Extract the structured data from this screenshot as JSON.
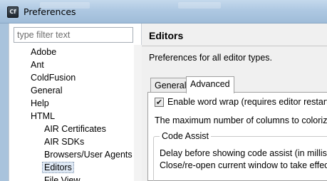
{
  "window": {
    "title": "Preferences",
    "icon_text": "Cf",
    "icon_name": "coldfusion-builder-icon"
  },
  "sidebar": {
    "filter_placeholder": "type filter text",
    "items": [
      {
        "label": "Adobe",
        "level": 1
      },
      {
        "label": "Ant",
        "level": 1
      },
      {
        "label": "ColdFusion",
        "level": 1
      },
      {
        "label": "General",
        "level": 1
      },
      {
        "label": "Help",
        "level": 1
      },
      {
        "label": "HTML",
        "level": 1
      },
      {
        "label": "AIR Certificates",
        "level": 2
      },
      {
        "label": "AIR SDKs",
        "level": 2
      },
      {
        "label": "Browsers/User Agents",
        "level": 2
      },
      {
        "label": "Editors",
        "level": 2,
        "selected": true
      },
      {
        "label": "File View",
        "level": 2
      }
    ]
  },
  "main": {
    "title": "Editors",
    "description": "Preferences for all editor types.",
    "tabs": [
      {
        "label": "General",
        "active": false
      },
      {
        "label": "Advanced",
        "active": true
      }
    ],
    "word_wrap": {
      "label": "Enable word wrap (requires editor restart)",
      "checked": true
    },
    "max_columns_text": "The maximum number of columns to colorize",
    "code_assist": {
      "legend": "Code Assist",
      "line1": "Delay before showing code assist (in millisec",
      "line2": "Close/re-open current window to take effect"
    }
  },
  "colors": {
    "titlebar": "#aec8e2",
    "selection": "#dfe9f5",
    "pane_background": "#f0f0f0"
  }
}
